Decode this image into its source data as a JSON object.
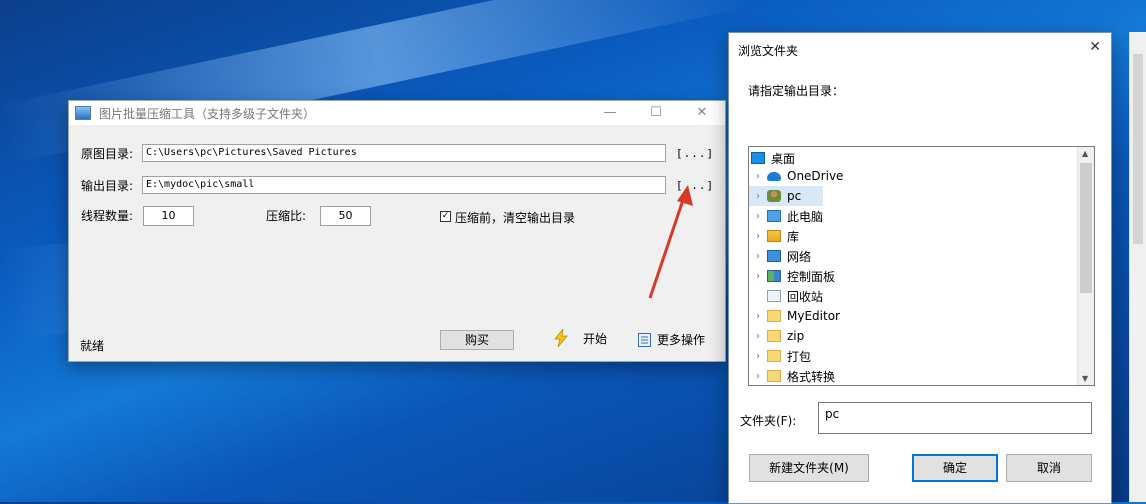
{
  "tool_window": {
    "title": "图片批量压缩工具（支持多级子文件夹）",
    "minimize_glyph": "—",
    "maximize_glyph": "☐",
    "close_glyph": "✕",
    "source_label": "原图目录:",
    "source_path": "C:\\Users\\pc\\Pictures\\Saved Pictures",
    "browse_label": "[...]",
    "output_label": "输出目录:",
    "output_path": "E:\\mydoc\\pic\\small",
    "threads_label": "线程数量:",
    "threads_value": "10",
    "ratio_label": "压缩比:",
    "ratio_value": "50",
    "clear_output_checked": true,
    "clear_output_label": "压缩前，清空输出目录",
    "status_text": "就绪",
    "buy_label": "购买",
    "start_label": "开始",
    "more_label": "更多操作"
  },
  "dialog": {
    "title": "浏览文件夹",
    "close_glyph": "✕",
    "prompt": "请指定输出目录：",
    "tree_items": [
      {
        "label": "桌面",
        "icon": "desktop-icon",
        "expander": ""
      },
      {
        "label": "OneDrive",
        "icon": "cloud-icon",
        "expander": "›"
      },
      {
        "label": "pc",
        "icon": "user-icon",
        "expander": "›"
      },
      {
        "label": "此电脑",
        "icon": "computer-icon",
        "expander": "›"
      },
      {
        "label": "库",
        "icon": "library-icon",
        "expander": "›"
      },
      {
        "label": "网络",
        "icon": "network-icon",
        "expander": "›"
      },
      {
        "label": "控制面板",
        "icon": "control-panel-icon",
        "expander": "›"
      },
      {
        "label": "回收站",
        "icon": "recycle-bin-icon",
        "expander": ""
      },
      {
        "label": "MyEditor",
        "icon": "folder-icon",
        "expander": "›"
      },
      {
        "label": "zip",
        "icon": "folder-icon",
        "expander": "›"
      },
      {
        "label": "打包",
        "icon": "folder-icon",
        "expander": "›"
      },
      {
        "label": "格式转换",
        "icon": "folder-icon",
        "expander": "›"
      }
    ],
    "folder_label": "文件夹(F):",
    "folder_value": "pc",
    "new_folder_label": "新建文件夹(M)",
    "ok_label": "确定",
    "cancel_label": "取消"
  },
  "colors": {
    "accent": "#0078d7",
    "arrow": "#d83a2a"
  }
}
